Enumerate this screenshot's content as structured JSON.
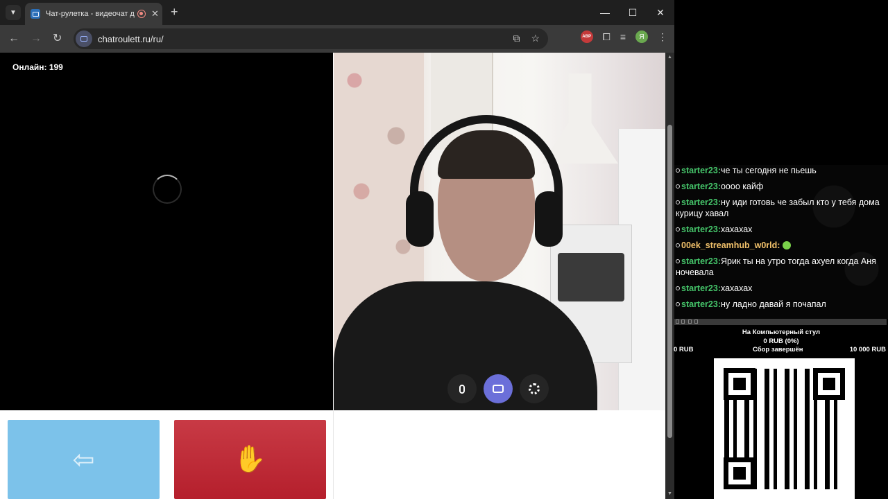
{
  "browser": {
    "tab_title": "Чат-рулетка - видеочат для",
    "url": "chatroulett.ru/ru/",
    "extension_badge": "ABP",
    "profile_initial": "Я",
    "icons": {
      "tab_search": "chevron-down-icon",
      "new_tab": "plus-icon",
      "back": "arrow-left-icon",
      "forward": "arrow-right-icon",
      "reload": "reload-icon",
      "install": "install-app-icon",
      "bookmark": "star-icon",
      "extensions": "puzzle-icon",
      "media": "media-controls-icon",
      "menu": "kebab-menu-icon"
    }
  },
  "page": {
    "online_label": "Онлайн: 199",
    "accent_color": "#6b6fd9",
    "prev_button_color": "#7cc2ea",
    "stop_button_color": "#c0303c"
  },
  "chat": {
    "messages": [
      {
        "user": "starter23:",
        "text": "че ты сегодня не пьешь"
      },
      {
        "user": "starter23:",
        "text": "оооо кайф"
      },
      {
        "user": "starter23:",
        "text": "ну иди готовь че забыл кто у тебя дома курицу хавал"
      },
      {
        "user": "starter23:",
        "text": "хахахах"
      },
      {
        "user": "00ek_streamhub_w0rld:",
        "text": ""
      },
      {
        "user": "starter23:",
        "text": "Ярик ты на утро тогда ахуел когда Аня ночевала"
      },
      {
        "user": "starter23:",
        "text": "хахахах"
      },
      {
        "user": "starter23:",
        "text": "ну ладно давай я почапал"
      }
    ]
  },
  "donation_goal": {
    "title": "На Компьютерный стул",
    "amount": "0 RUB (0%)",
    "min": "0 RUB",
    "status": "Сбор завершён",
    "max": "10 000 RUB"
  }
}
